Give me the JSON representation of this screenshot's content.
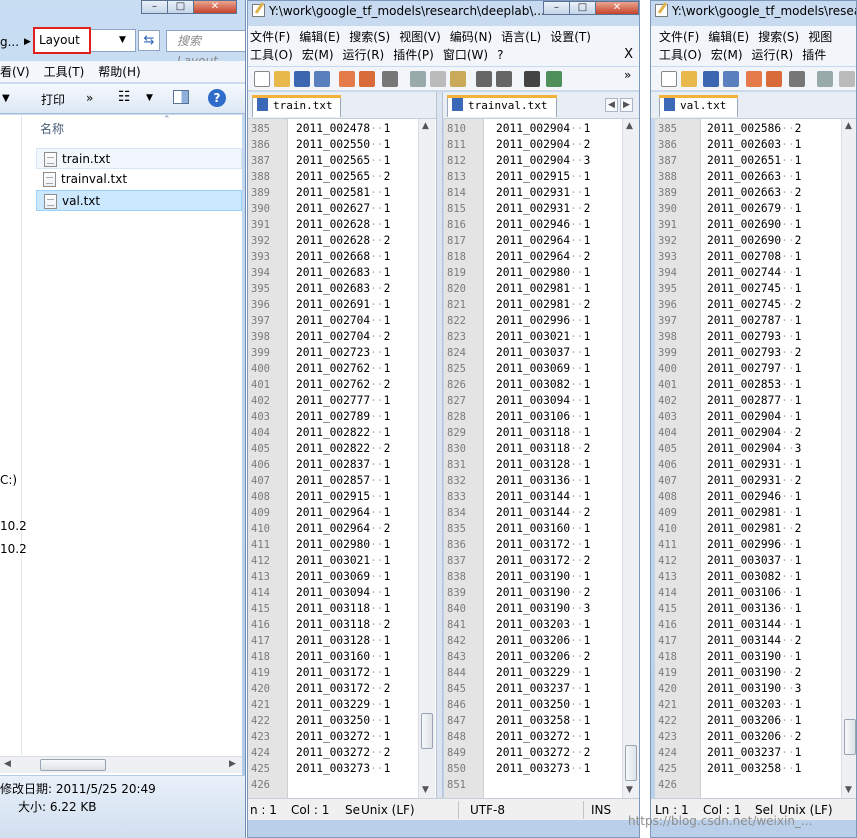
{
  "explorer": {
    "address_prev": "g...",
    "address_crumb": "Layout",
    "search_placeholder": "搜索 Layout",
    "menu": [
      "看(V)",
      "工具(T)",
      "帮助(H)"
    ],
    "toolbar_print": "打印",
    "toolbar_more": "»",
    "column_name": "名称",
    "files": [
      "train.txt",
      "trainval.txt",
      "val.txt"
    ],
    "nav_items": [
      "C:)",
      "10.2",
      "10.2"
    ],
    "details_modified": "修改日期: 2011/5/25 20:49",
    "details_size": "大小: 6.22 KB"
  },
  "windows": [
    {
      "title": "Y:\\work\\google_tf_models\\research\\deeplab\\...",
      "menu_row1": [
        "文件(F)",
        "编辑(E)",
        "搜索(S)",
        "视图(V)",
        "编码(N)",
        "语言(L)",
        "设置(T)"
      ],
      "menu_row2": [
        "工具(O)",
        "宏(M)",
        "运行(R)",
        "插件(P)",
        "窗口(W)",
        "?"
      ],
      "menu_close": "X",
      "tab": "train.txt",
      "lines": [
        [
          "385",
          "2011_002478",
          "1"
        ],
        [
          "386",
          "2011_002550",
          "1"
        ],
        [
          "387",
          "2011_002565",
          "1"
        ],
        [
          "388",
          "2011_002565",
          "2"
        ],
        [
          "389",
          "2011_002581",
          "1"
        ],
        [
          "390",
          "2011_002627",
          "1"
        ],
        [
          "391",
          "2011_002628",
          "1"
        ],
        [
          "392",
          "2011_002628",
          "2"
        ],
        [
          "393",
          "2011_002668",
          "1"
        ],
        [
          "394",
          "2011_002683",
          "1"
        ],
        [
          "395",
          "2011_002683",
          "2"
        ],
        [
          "396",
          "2011_002691",
          "1"
        ],
        [
          "397",
          "2011_002704",
          "1"
        ],
        [
          "398",
          "2011_002704",
          "2"
        ],
        [
          "399",
          "2011_002723",
          "1"
        ],
        [
          "400",
          "2011_002762",
          "1"
        ],
        [
          "401",
          "2011_002762",
          "2"
        ],
        [
          "402",
          "2011_002777",
          "1"
        ],
        [
          "403",
          "2011_002789",
          "1"
        ],
        [
          "404",
          "2011_002822",
          "1"
        ],
        [
          "405",
          "2011_002822",
          "2"
        ],
        [
          "406",
          "2011_002837",
          "1"
        ],
        [
          "407",
          "2011_002857",
          "1"
        ],
        [
          "408",
          "2011_002915",
          "1"
        ],
        [
          "409",
          "2011_002964",
          "1"
        ],
        [
          "410",
          "2011_002964",
          "2"
        ],
        [
          "411",
          "2011_002980",
          "1"
        ],
        [
          "412",
          "2011_003021",
          "1"
        ],
        [
          "413",
          "2011_003069",
          "1"
        ],
        [
          "414",
          "2011_003094",
          "1"
        ],
        [
          "415",
          "2011_003118",
          "1"
        ],
        [
          "416",
          "2011_003118",
          "2"
        ],
        [
          "417",
          "2011_003128",
          "1"
        ],
        [
          "418",
          "2011_003160",
          "1"
        ],
        [
          "419",
          "2011_003172",
          "1"
        ],
        [
          "420",
          "2011_003172",
          "2"
        ],
        [
          "421",
          "2011_003229",
          "1"
        ],
        [
          "422",
          "2011_003250",
          "1"
        ],
        [
          "423",
          "2011_003272",
          "1"
        ],
        [
          "424",
          "2011_003272",
          "2"
        ],
        [
          "425",
          "2011_003273",
          "1"
        ],
        [
          "426",
          "",
          ""
        ]
      ],
      "status": [
        "n : 1",
        "Col : 1",
        "Se",
        "Unix (LF)"
      ]
    },
    {
      "tab": "trainval.txt",
      "lines": [
        [
          "810",
          "2011_002904",
          "1"
        ],
        [
          "811",
          "2011_002904",
          "2"
        ],
        [
          "812",
          "2011_002904",
          "3"
        ],
        [
          "813",
          "2011_002915",
          "1"
        ],
        [
          "814",
          "2011_002931",
          "1"
        ],
        [
          "815",
          "2011_002931",
          "2"
        ],
        [
          "816",
          "2011_002946",
          "1"
        ],
        [
          "817",
          "2011_002964",
          "1"
        ],
        [
          "818",
          "2011_002964",
          "2"
        ],
        [
          "819",
          "2011_002980",
          "1"
        ],
        [
          "820",
          "2011_002981",
          "1"
        ],
        [
          "821",
          "2011_002981",
          "2"
        ],
        [
          "822",
          "2011_002996",
          "1"
        ],
        [
          "823",
          "2011_003021",
          "1"
        ],
        [
          "824",
          "2011_003037",
          "1"
        ],
        [
          "825",
          "2011_003069",
          "1"
        ],
        [
          "826",
          "2011_003082",
          "1"
        ],
        [
          "827",
          "2011_003094",
          "1"
        ],
        [
          "828",
          "2011_003106",
          "1"
        ],
        [
          "829",
          "2011_003118",
          "1"
        ],
        [
          "830",
          "2011_003118",
          "2"
        ],
        [
          "831",
          "2011_003128",
          "1"
        ],
        [
          "832",
          "2011_003136",
          "1"
        ],
        [
          "833",
          "2011_003144",
          "1"
        ],
        [
          "834",
          "2011_003144",
          "2"
        ],
        [
          "835",
          "2011_003160",
          "1"
        ],
        [
          "836",
          "2011_003172",
          "1"
        ],
        [
          "837",
          "2011_003172",
          "2"
        ],
        [
          "838",
          "2011_003190",
          "1"
        ],
        [
          "839",
          "2011_003190",
          "2"
        ],
        [
          "840",
          "2011_003190",
          "3"
        ],
        [
          "841",
          "2011_003203",
          "1"
        ],
        [
          "842",
          "2011_003206",
          "1"
        ],
        [
          "843",
          "2011_003206",
          "2"
        ],
        [
          "844",
          "2011_003229",
          "1"
        ],
        [
          "845",
          "2011_003237",
          "1"
        ],
        [
          "846",
          "2011_003250",
          "1"
        ],
        [
          "847",
          "2011_003258",
          "1"
        ],
        [
          "848",
          "2011_003272",
          "1"
        ],
        [
          "849",
          "2011_003272",
          "2"
        ],
        [
          "850",
          "2011_003273",
          "1"
        ],
        [
          "851",
          "",
          ""
        ]
      ],
      "status": [
        "UTF-8",
        "INS"
      ]
    },
    {
      "title": "Y:\\work\\google_tf_models\\resea",
      "menu_row1": [
        "文件(F)",
        "编辑(E)",
        "搜索(S)",
        "视图"
      ],
      "menu_row2": [
        "工具(O)",
        "宏(M)",
        "运行(R)",
        "插件"
      ],
      "tab": "val.txt",
      "lines": [
        [
          "385",
          "2011_002586",
          "2"
        ],
        [
          "386",
          "2011_002603",
          "1"
        ],
        [
          "387",
          "2011_002651",
          "1"
        ],
        [
          "388",
          "2011_002663",
          "1"
        ],
        [
          "389",
          "2011_002663",
          "2"
        ],
        [
          "390",
          "2011_002679",
          "1"
        ],
        [
          "391",
          "2011_002690",
          "1"
        ],
        [
          "392",
          "2011_002690",
          "2"
        ],
        [
          "393",
          "2011_002708",
          "1"
        ],
        [
          "394",
          "2011_002744",
          "1"
        ],
        [
          "395",
          "2011_002745",
          "1"
        ],
        [
          "396",
          "2011_002745",
          "2"
        ],
        [
          "397",
          "2011_002787",
          "1"
        ],
        [
          "398",
          "2011_002793",
          "1"
        ],
        [
          "399",
          "2011_002793",
          "2"
        ],
        [
          "400",
          "2011_002797",
          "1"
        ],
        [
          "401",
          "2011_002853",
          "1"
        ],
        [
          "402",
          "2011_002877",
          "1"
        ],
        [
          "403",
          "2011_002904",
          "1"
        ],
        [
          "404",
          "2011_002904",
          "2"
        ],
        [
          "405",
          "2011_002904",
          "3"
        ],
        [
          "406",
          "2011_002931",
          "1"
        ],
        [
          "407",
          "2011_002931",
          "2"
        ],
        [
          "408",
          "2011_002946",
          "1"
        ],
        [
          "409",
          "2011_002981",
          "1"
        ],
        [
          "410",
          "2011_002981",
          "2"
        ],
        [
          "411",
          "2011_002996",
          "1"
        ],
        [
          "412",
          "2011_003037",
          "1"
        ],
        [
          "413",
          "2011_003082",
          "1"
        ],
        [
          "414",
          "2011_003106",
          "1"
        ],
        [
          "415",
          "2011_003136",
          "1"
        ],
        [
          "416",
          "2011_003144",
          "1"
        ],
        [
          "417",
          "2011_003144",
          "2"
        ],
        [
          "418",
          "2011_003190",
          "1"
        ],
        [
          "419",
          "2011_003190",
          "2"
        ],
        [
          "420",
          "2011_003190",
          "3"
        ],
        [
          "421",
          "2011_003203",
          "1"
        ],
        [
          "422",
          "2011_003206",
          "1"
        ],
        [
          "423",
          "2011_003206",
          "2"
        ],
        [
          "424",
          "2011_003237",
          "1"
        ],
        [
          "425",
          "2011_003258",
          "1"
        ],
        [
          "426",
          "",
          ""
        ]
      ],
      "status": [
        "Ln : 1",
        "Col : 1",
        "Sel",
        "Unix (LF)"
      ]
    }
  ],
  "watermark": "https://blog.csdn.net/weixin_..."
}
